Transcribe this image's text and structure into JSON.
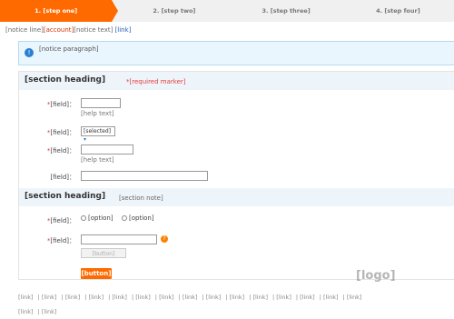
{
  "steps": [
    {
      "label": "1. [step one]",
      "active": true
    },
    {
      "label": "2. [step two]",
      "active": false
    },
    {
      "label": "3. [step three]",
      "active": false
    },
    {
      "label": "4. [step four]",
      "active": false
    }
  ],
  "notice": {
    "prefix": "[notice line]",
    "highlight": "[account]",
    "middle": "[notice text]",
    "link": "[link]"
  },
  "tip": {
    "text": "[notice paragraph]"
  },
  "section_basic": {
    "title": "[section heading]",
    "note": "*[required marker]"
  },
  "fields": {
    "real_name_label": "[field]：",
    "real_name_hint": "[help text]",
    "region_label": "[field]：",
    "region_value": "[selected]",
    "id_number_label": "[field]：",
    "id_number_hint": "[help text]",
    "address_label": "[field]："
  },
  "section_result": {
    "title": "[section heading]",
    "note": "[section note]"
  },
  "result_fields": {
    "method_label": "[field]：",
    "option_phone": "[option]",
    "option_email": "[option]",
    "email_label": "[field]：",
    "verify_button": "[button]"
  },
  "next_button": "[button]",
  "footer_links": [
    "[link]",
    "[link]",
    "[link]",
    "[link]",
    "[link]",
    "[link]",
    "[link]",
    "[link]",
    "[link]",
    "[link]",
    "[link]",
    "[link]",
    "[link]",
    "[link]",
    "[link]",
    "[link]",
    "[link]"
  ],
  "watermark": "[logo]"
}
